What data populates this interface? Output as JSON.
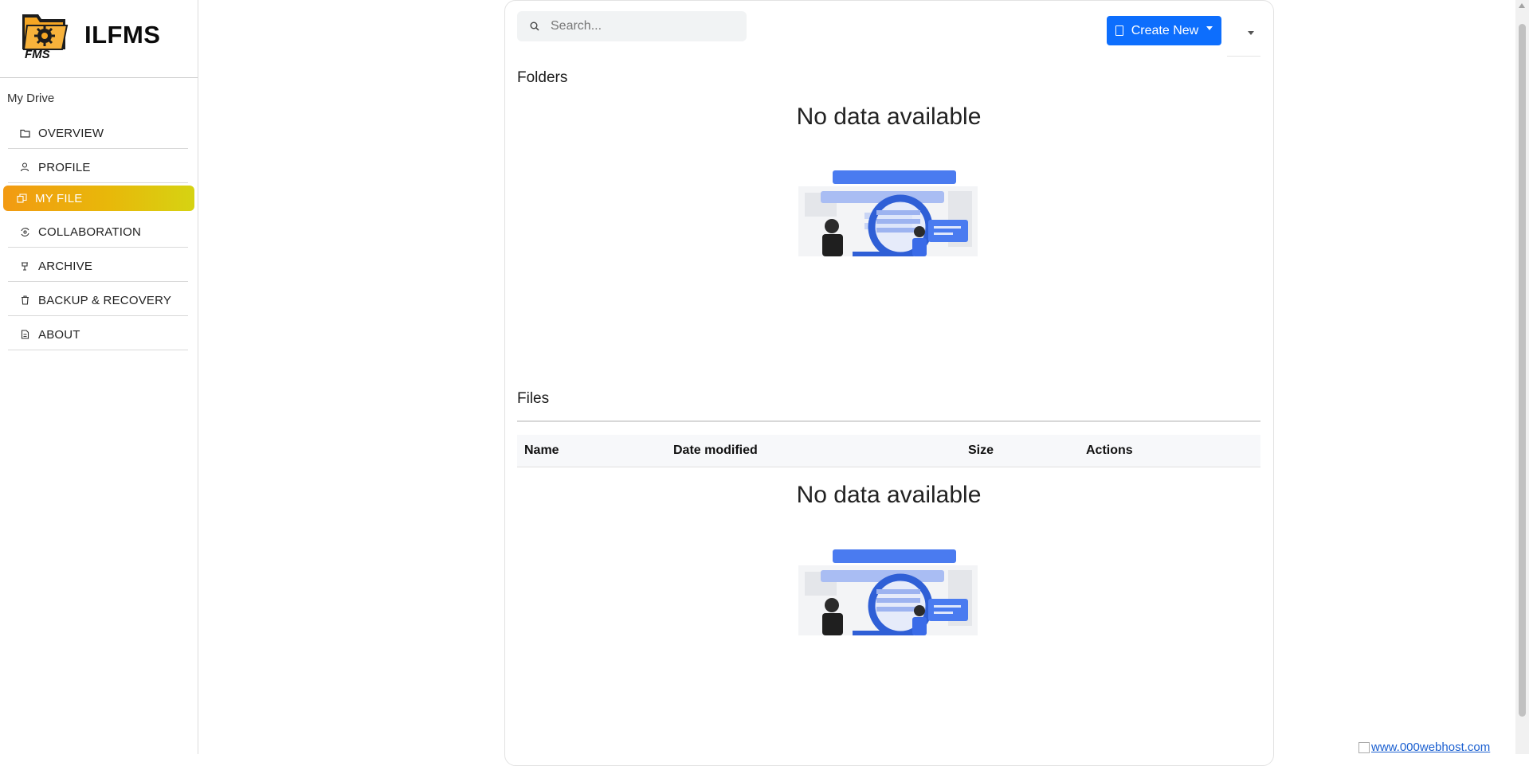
{
  "app": {
    "name": "ILFMS",
    "logo_text": "FMS"
  },
  "sidebar": {
    "section_label": "My Drive",
    "items": [
      {
        "label": "OVERVIEW",
        "icon": "folder-icon",
        "active": false
      },
      {
        "label": "PROFILE",
        "icon": "user-icon",
        "active": false
      },
      {
        "label": "MY FILE",
        "icon": "files-icon",
        "active": true
      },
      {
        "label": "COLLABORATION",
        "icon": "collaboration-icon",
        "active": false
      },
      {
        "label": "ARCHIVE",
        "icon": "archive-icon",
        "active": false
      },
      {
        "label": "BACKUP & RECOVERY",
        "icon": "trash-icon",
        "active": false
      },
      {
        "label": "ABOUT",
        "icon": "document-icon",
        "active": false
      }
    ]
  },
  "search": {
    "placeholder": "Search..."
  },
  "toolbar": {
    "create_label": "Create New"
  },
  "folders": {
    "title": "Folders",
    "empty_text": "No data available"
  },
  "files": {
    "title": "Files",
    "columns": [
      "Name",
      "Date modified",
      "Size",
      "Actions"
    ],
    "empty_text": "No data available"
  },
  "footer": {
    "host_link": "www.000webhost.com"
  },
  "colors": {
    "primary": "#0d6efd",
    "active_gradient_start": "#f29a12",
    "active_gradient_end": "#d6d312",
    "illustration_blue": "#4a7bf0"
  }
}
